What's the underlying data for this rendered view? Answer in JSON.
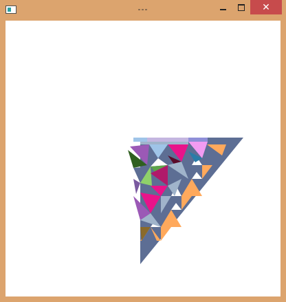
{
  "window": {
    "title": "---",
    "minimize_icon": "minimize-icon",
    "maximize_icon": "maximize-icon",
    "close_icon": "close-icon",
    "close_glyph": "✕",
    "colors": {
      "frame": "#dca46e",
      "close_button": "#c74b4c",
      "client_background": "#ffffff"
    }
  },
  "scene": {
    "description_icon": "triangle-mosaic",
    "palette": [
      "#5d6e94",
      "#ffa95c",
      "#a0b4cb",
      "#e8138a",
      "#9b59b6",
      "#2f5f1f",
      "#8fd16a",
      "#f29bf2",
      "#5a0b2a",
      "#ffffff"
    ]
  }
}
